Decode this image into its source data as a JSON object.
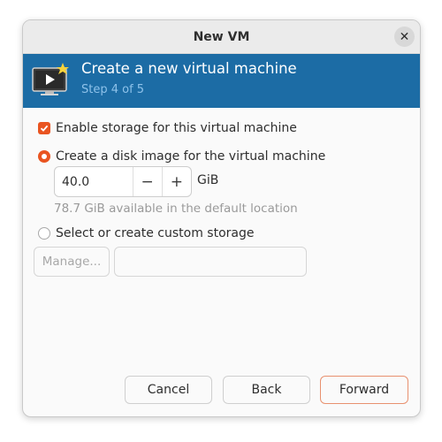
{
  "window": {
    "title": "New VM"
  },
  "header": {
    "title": "Create a new virtual machine",
    "step": "Step 4 of 5"
  },
  "storage": {
    "enable_label": "Enable storage for this virtual machine",
    "enable_checked": true,
    "create_disk_label": "Create a disk image for the virtual machine",
    "create_disk_selected": true,
    "disk_size": "40.0",
    "disk_unit": "GiB",
    "available_hint": "78.7 GiB available in the default location",
    "custom_label": "Select or create custom storage",
    "custom_selected": false,
    "manage_label": "Manage...",
    "custom_path": ""
  },
  "buttons": {
    "cancel": "Cancel",
    "back": "Back",
    "forward": "Forward"
  },
  "colors": {
    "accent": "#e95420",
    "header_bg": "#1c6ca5"
  },
  "icons": {
    "close": "close-icon",
    "header": "monitor-play-icon",
    "minus": "minus-icon",
    "plus": "plus-icon"
  }
}
